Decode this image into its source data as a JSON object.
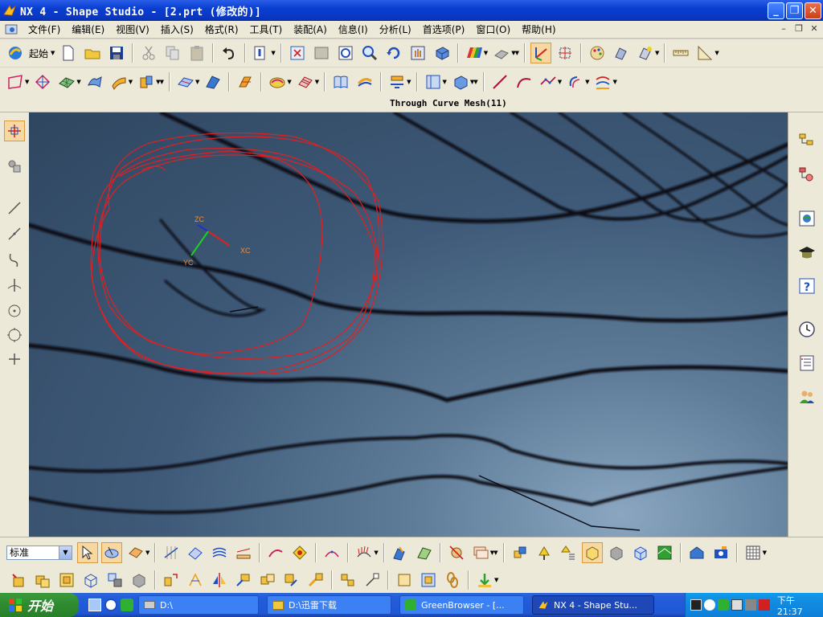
{
  "window": {
    "title": "NX 4 - Shape Studio - [2.prt (修改的)]"
  },
  "menubar": {
    "items": [
      "文件(F)",
      "编辑(E)",
      "视图(V)",
      "插入(S)",
      "格式(R)",
      "工具(T)",
      "装配(A)",
      "信息(I)",
      "分析(L)",
      "首选项(P)",
      "窗口(O)",
      "帮助(H)"
    ]
  },
  "toolbar": {
    "start_label": "起始"
  },
  "status": {
    "cue": "Through Curve Mesh(11)"
  },
  "viewport": {
    "axes": {
      "zc": "ZC",
      "xc": "XC",
      "yc": "YC"
    },
    "colors": {
      "annotation": "#e02020",
      "curve": "#0b0f18",
      "background": "#3e5a78"
    }
  },
  "selection": {
    "filter_value": "标准"
  },
  "taskbar": {
    "start_label": "开始",
    "tasks": [
      {
        "label": "D:\\",
        "icon": "drive-icon"
      },
      {
        "label": "D:\\迅雷下载",
        "icon": "folder-icon"
      },
      {
        "label": "GreenBrowser - [...",
        "icon": "browser-icon"
      },
      {
        "label": "NX 4 - Shape Stu...",
        "icon": "nx-icon"
      }
    ],
    "clock": "下午 21:37"
  }
}
